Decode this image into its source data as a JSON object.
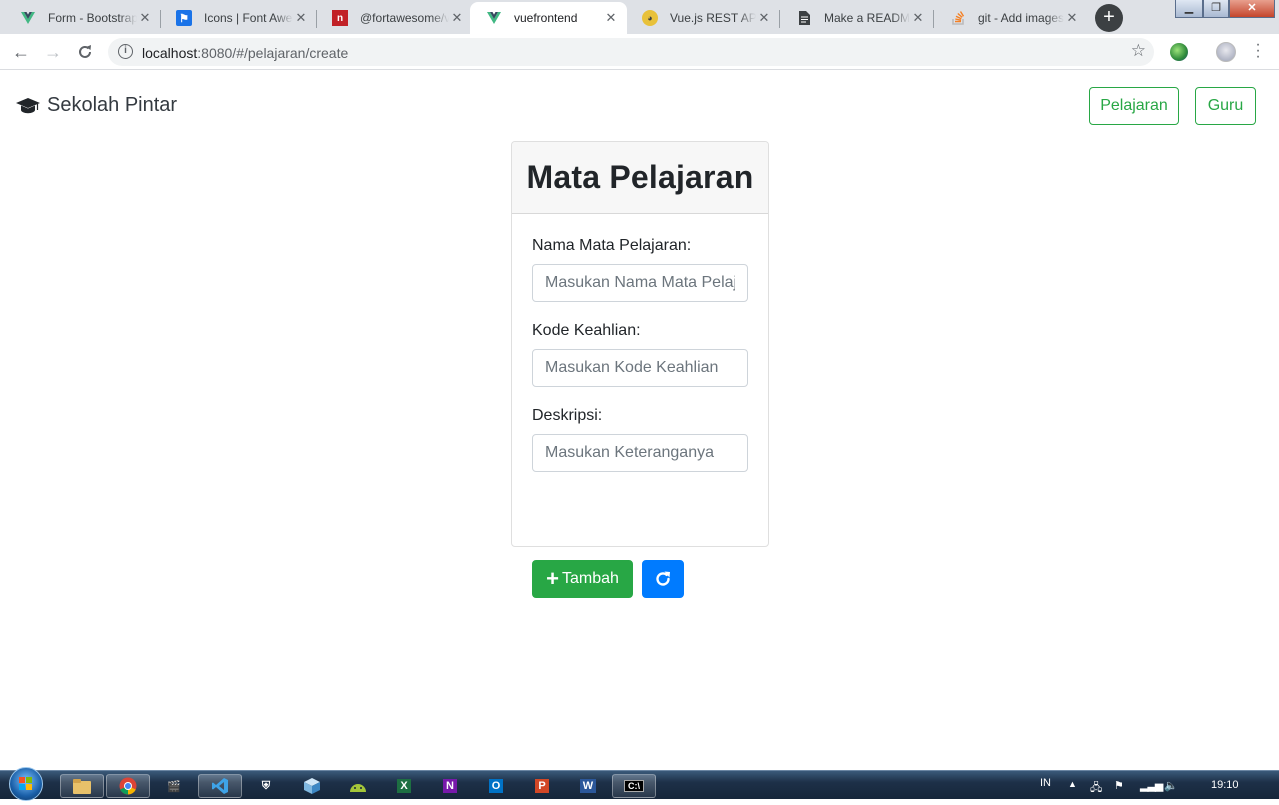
{
  "browser": {
    "tabs": [
      {
        "title": "Form - Bootstrap",
        "icon": "vue-icon",
        "color": "#41b883"
      },
      {
        "title": "Icons | Font Awesome",
        "icon": "flag-icon",
        "color": "#1a73e8"
      },
      {
        "title": "@fortawesome/vue-fontawesome",
        "icon": "npm-icon",
        "color": "#c12127"
      },
      {
        "title": "vuefrontend",
        "icon": "vue-icon",
        "color": "#41b883"
      },
      {
        "title": "Vue.js REST API CRUD",
        "icon": "bird-icon",
        "color": "#e8c13a"
      },
      {
        "title": "Make a README",
        "icon": "document-icon",
        "color": "#3c4043"
      },
      {
        "title": "git - Add images",
        "icon": "stackoverflow-icon",
        "color": "#f48024"
      }
    ],
    "url_host": "localhost",
    "url_path": ":8080/#/pelajaran/create",
    "new_tab_label": "+"
  },
  "app": {
    "brand": "Sekolah Pintar",
    "nav": {
      "pelajaran": "Pelajaran",
      "guru": "Guru"
    },
    "accent_color": "#28a745"
  },
  "form": {
    "title": "Mata Pelajaran",
    "fields": [
      {
        "label": "Nama Mata Pelajaran:",
        "placeholder": "Masukan Nama Mata Pelajaran",
        "value": ""
      },
      {
        "label": "Kode Keahlian:",
        "placeholder": "Masukan Kode Keahlian",
        "value": ""
      },
      {
        "label": "Deskripsi:",
        "placeholder": "Masukan Keteranganya",
        "value": ""
      }
    ],
    "submit_label": "Tambah",
    "submit_icon": "plus-icon",
    "reset_icon": "redo-icon"
  },
  "taskbar": {
    "apps": [
      "explorer",
      "chrome",
      "clapper",
      "vscode",
      "vue-devtools",
      "box",
      "android",
      "excel",
      "onenote",
      "outlook",
      "powerpoint",
      "word",
      "cmd"
    ],
    "language": "IN",
    "clock": "19:10"
  }
}
